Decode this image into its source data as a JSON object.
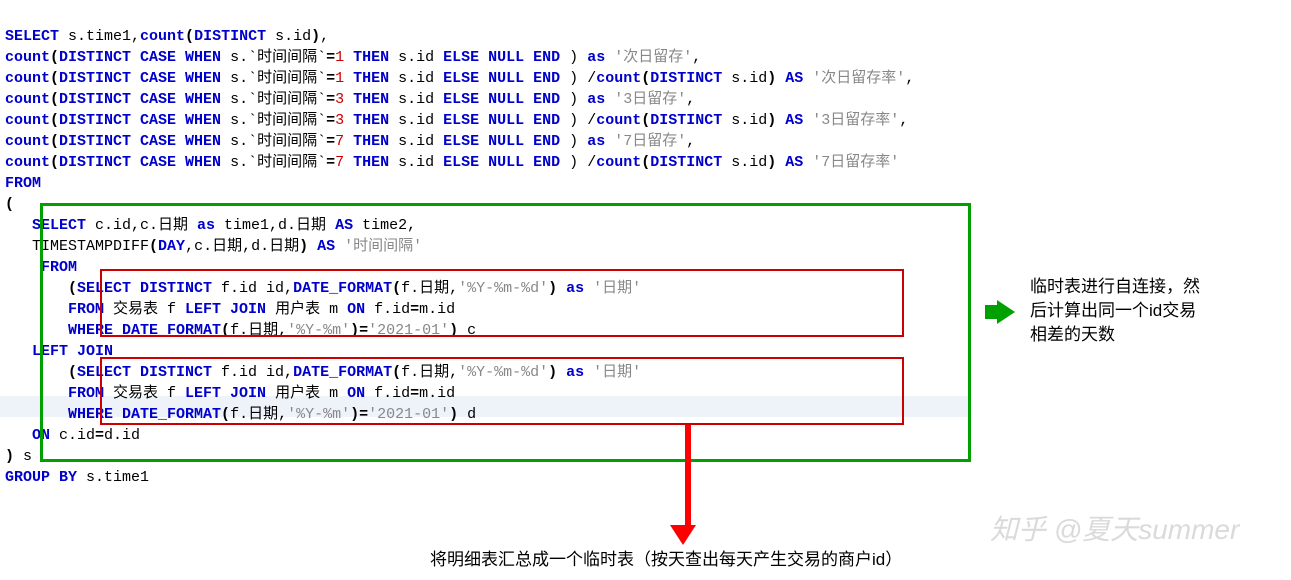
{
  "sql": {
    "l1": {
      "a": "SELECT",
      "b": " s.time1,",
      "c": "count",
      "d": "(",
      "e": "DISTINCT",
      "f": " s.id",
      "g": ")",
      "h": ","
    },
    "l2": {
      "a": "count",
      "b": "(",
      "c": "DISTINCT CASE WHEN",
      "d": " s.`时间间隔`",
      "e": "=",
      "f": "1",
      "g": " THEN",
      "h": " s.id ",
      "i": "ELSE NULL END",
      "j": " )",
      "k": " as",
      "l": " '次日留存'",
      "m": ","
    },
    "l3": {
      "a": "count",
      "b": "(",
      "c": "DISTINCT CASE WHEN",
      "d": " s.`时间间隔`",
      "e": "=",
      "f": "1",
      "g": " THEN",
      "h": " s.id ",
      "i": "ELSE NULL END",
      "j": " )",
      "k": " /",
      "l": "count",
      "m": "(",
      "n": "DISTINCT",
      "o": " s.id",
      "p": ")",
      "q": " AS",
      "r": " '次日留存率'",
      "s": ","
    },
    "l4": {
      "a": "count",
      "b": "(",
      "c": "DISTINCT CASE WHEN",
      "d": " s.`时间间隔`",
      "e": "=",
      "f": "3",
      "g": " THEN",
      "h": " s.id ",
      "i": "ELSE NULL END",
      "j": " )",
      "k": " as",
      "l": " '3日留存'",
      "m": ","
    },
    "l5": {
      "a": "count",
      "b": "(",
      "c": "DISTINCT CASE WHEN",
      "d": " s.`时间间隔`",
      "e": "=",
      "f": "3",
      "g": " THEN",
      "h": " s.id ",
      "i": "ELSE NULL END",
      "j": " )",
      "k": " /",
      "l": "count",
      "m": "(",
      "n": "DISTINCT",
      "o": " s.id",
      "p": ")",
      "q": " AS",
      "r": " '3日留存率'",
      "s": ","
    },
    "l6": {
      "a": "count",
      "b": "(",
      "c": "DISTINCT CASE WHEN",
      "d": " s.`时间间隔`",
      "e": "=",
      "f": "7",
      "g": " THEN",
      "h": " s.id ",
      "i": "ELSE NULL END",
      "j": " )",
      "k": " as",
      "l": " '7日留存'",
      "m": ","
    },
    "l7": {
      "a": "count",
      "b": "(",
      "c": "DISTINCT CASE WHEN",
      "d": " s.`时间间隔`",
      "e": "=",
      "f": "7",
      "g": " THEN",
      "h": " s.id ",
      "i": "ELSE NULL END",
      "j": " )",
      "k": " /",
      "l": "count",
      "m": "(",
      "n": "DISTINCT",
      "o": " s.id",
      "p": ")",
      "q": " AS",
      "r": " '7日留存率'"
    },
    "l8": {
      "a": "FROM"
    },
    "l9": {
      "a": "("
    },
    "l10": {
      "a": "   SELECT",
      "b": " c.id,c.日期 ",
      "c": "as",
      "d": " time1,d.日期 ",
      "e": "AS",
      "f": " time2,"
    },
    "l11": {
      "a": "   TIMESTAMPDIFF",
      "b": "(",
      "c": "DAY",
      "d": ",c.日期,d.日期",
      "e": ")",
      "f": " AS",
      "g": " '时间间隔'"
    },
    "l12": {
      "a": "    FROM"
    },
    "l13": {
      "a": "       (",
      "b": "SELECT DISTINCT",
      "c": " f.id id,",
      "d": "DATE_FORMAT",
      "e": "(",
      "f": "f.日期,",
      "g": "'%Y-%m-%d'",
      "h": ")",
      "i": " as",
      "j": " '日期'"
    },
    "l14": {
      "a": "       FROM",
      "b": " 交易表 f ",
      "c": "LEFT JOIN",
      "d": " 用户表 m ",
      "e": "ON",
      "f": " f.id",
      "g": "=",
      "h": "m.id"
    },
    "l15": {
      "a": "       WHERE DATE_FORMAT",
      "b": "(",
      "c": "f.日期,",
      "d": "'%Y-%m'",
      "e": ")",
      "f": "=",
      "g": "'2021-01'",
      "h": ")",
      "i": " c"
    },
    "l16": {
      "a": "   LEFT JOIN"
    },
    "l17": {
      "a": "       (",
      "b": "SELECT DISTINCT",
      "c": " f.id id,",
      "d": "DATE_FORMAT",
      "e": "(",
      "f": "f.日期,",
      "g": "'%Y-%m-%d'",
      "h": ")",
      "i": " as",
      "j": " '日期'"
    },
    "l18": {
      "a": "       FROM",
      "b": " 交易表 f ",
      "c": "LEFT JOIN",
      "d": " 用户表 m ",
      "e": "ON",
      "f": " f.id",
      "g": "=",
      "h": "m.id"
    },
    "l19": {
      "a": "       WHERE DATE_FORMAT",
      "b": "(",
      "c": "f.日期,",
      "d": "'%Y-%m'",
      "e": ")",
      "f": "=",
      "g": "'2021-01'",
      "h": ")",
      "i": " d"
    },
    "l20": {
      "a": "   ON",
      "b": " c.id",
      "c": "=",
      "d": "d.id"
    },
    "l21": {
      "a": ")",
      "b": " s"
    },
    "l22": {
      "a": "GROUP BY",
      "b": " s.time1"
    }
  },
  "annotations": {
    "right": "临时表进行自连接，然\n后计算出同一个id交易\n相差的天数",
    "bottom": "将明细表汇总成一个临时表（按天查出每天产生交易的商户id）"
  },
  "watermark": "知乎 @夏天summer"
}
